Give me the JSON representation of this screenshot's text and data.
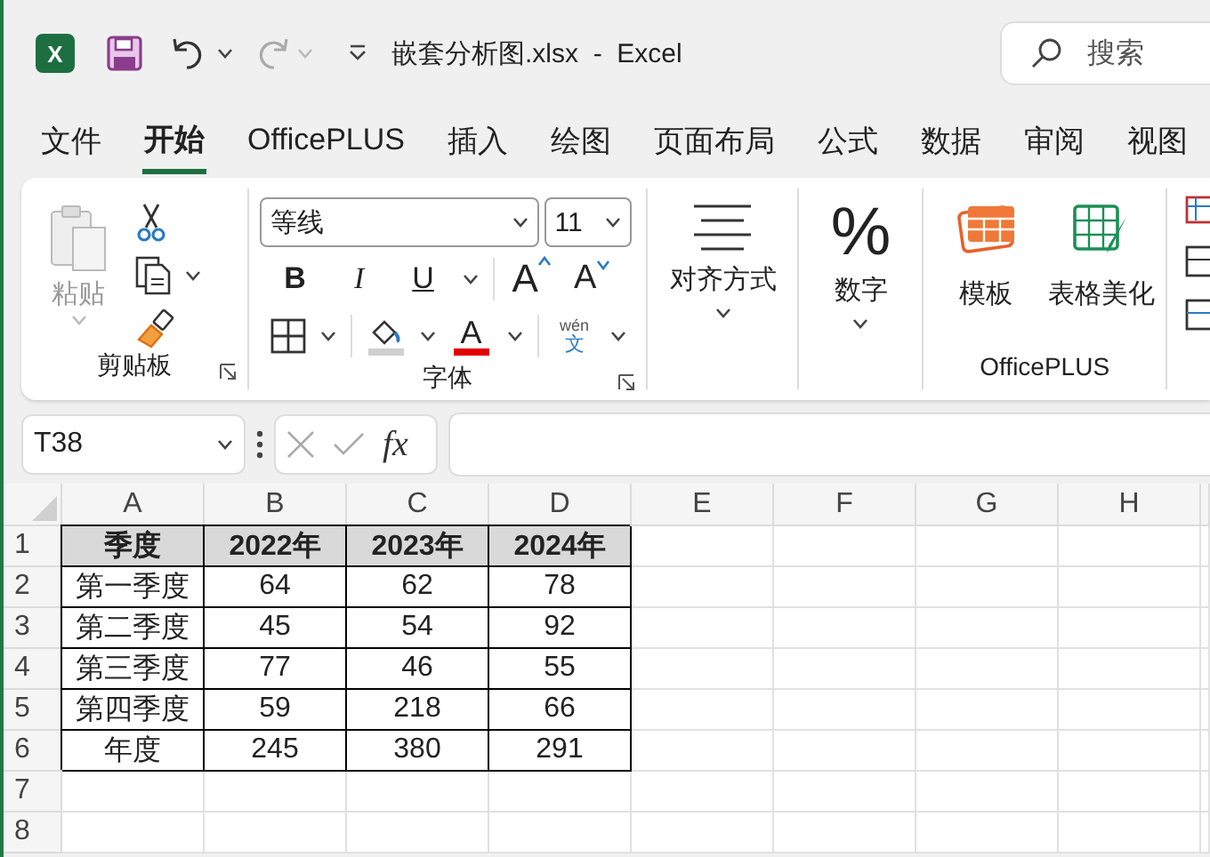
{
  "title_bar": {
    "app_letter": "X",
    "title": "嵌套分析图.xlsx  -  Excel",
    "redo": {
      "disabled": true
    },
    "search": {
      "placeholder": "搜索"
    }
  },
  "tabs": [
    {
      "label": "文件",
      "selected": false
    },
    {
      "label": "开始",
      "selected": true
    },
    {
      "label": "OfficePLUS",
      "selected": false
    },
    {
      "label": "插入",
      "selected": false
    },
    {
      "label": "绘图",
      "selected": false
    },
    {
      "label": "页面布局",
      "selected": false
    },
    {
      "label": "公式",
      "selected": false
    },
    {
      "label": "数据",
      "selected": false
    },
    {
      "label": "审阅",
      "selected": false
    },
    {
      "label": "视图",
      "selected": false
    }
  ],
  "ribbon": {
    "clipboard": {
      "paste": {
        "label": "粘贴",
        "disabled": true
      },
      "label": "剪贴板"
    },
    "font": {
      "name": "等线",
      "size": "11",
      "bold": "B",
      "italic": "I",
      "underline": "U",
      "grow": "A",
      "shrink": "A",
      "font_color": "A",
      "phonetic_top": "wén",
      "phonetic_bottom": "文",
      "label": "字体"
    },
    "alignment": {
      "label": "对齐方式"
    },
    "number": {
      "symbol": "%",
      "label": "数字"
    },
    "officeplus": {
      "template": "模板",
      "beautify": "表格美化",
      "label": "OfficePLUS"
    }
  },
  "formula_bar": {
    "name_box": "T38",
    "function_symbol": "fx"
  },
  "sheet": {
    "columns": [
      "A",
      "B",
      "C",
      "D",
      "E",
      "F",
      "G",
      "H"
    ],
    "rows": [
      {
        "number": "1",
        "cells": [
          {
            "text": "季度",
            "kind": "header"
          },
          {
            "text": "2022年",
            "kind": "header"
          },
          {
            "text": "2023年",
            "kind": "header"
          },
          {
            "text": "2024年",
            "kind": "header"
          }
        ]
      },
      {
        "number": "2",
        "cells": [
          {
            "text": "第一季度",
            "kind": "data"
          },
          {
            "text": "64",
            "kind": "data"
          },
          {
            "text": "62",
            "kind": "data"
          },
          {
            "text": "78",
            "kind": "data"
          }
        ]
      },
      {
        "number": "3",
        "cells": [
          {
            "text": "第二季度",
            "kind": "data"
          },
          {
            "text": "45",
            "kind": "data"
          },
          {
            "text": "54",
            "kind": "data"
          },
          {
            "text": "92",
            "kind": "data"
          }
        ]
      },
      {
        "number": "4",
        "cells": [
          {
            "text": "第三季度",
            "kind": "data"
          },
          {
            "text": "77",
            "kind": "data"
          },
          {
            "text": "46",
            "kind": "data"
          },
          {
            "text": "55",
            "kind": "data"
          }
        ]
      },
      {
        "number": "5",
        "cells": [
          {
            "text": "第四季度",
            "kind": "data"
          },
          {
            "text": "59",
            "kind": "data"
          },
          {
            "text": "218",
            "kind": "data"
          },
          {
            "text": "66",
            "kind": "data"
          }
        ]
      },
      {
        "number": "6",
        "cells": [
          {
            "text": "年度",
            "kind": "data"
          },
          {
            "text": "245",
            "kind": "data"
          },
          {
            "text": "380",
            "kind": "data"
          },
          {
            "text": "291",
            "kind": "data"
          }
        ]
      },
      {
        "number": "7",
        "cells": []
      },
      {
        "number": "8",
        "cells": []
      }
    ]
  }
}
